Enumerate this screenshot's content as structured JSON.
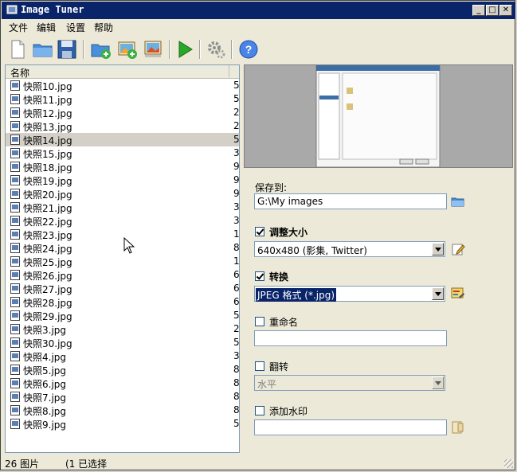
{
  "window": {
    "title": "Image Tuner"
  },
  "menu": [
    "文件",
    "编辑",
    "设置",
    "帮助"
  ],
  "toolbar": {
    "icons": [
      "new-file-icon",
      "open-folder-icon",
      "save-icon",
      "add-folder-icon",
      "add-image-icon",
      "add-image-alt-icon",
      "run-icon",
      "settings-icon",
      "help-icon"
    ]
  },
  "list": {
    "header": "名称",
    "rows": [
      {
        "name": "快照10.jpg",
        "size": "5"
      },
      {
        "name": "快照11.jpg",
        "size": "5"
      },
      {
        "name": "快照12.jpg",
        "size": "2"
      },
      {
        "name": "快照13.jpg",
        "size": "2"
      },
      {
        "name": "快照14.jpg",
        "size": "5"
      },
      {
        "name": "快照15.jpg",
        "size": "3"
      },
      {
        "name": "快照18.jpg",
        "size": "9"
      },
      {
        "name": "快照19.jpg",
        "size": "9"
      },
      {
        "name": "快照20.jpg",
        "size": "9"
      },
      {
        "name": "快照21.jpg",
        "size": "3"
      },
      {
        "name": "快照22.jpg",
        "size": "3"
      },
      {
        "name": "快照23.jpg",
        "size": "1"
      },
      {
        "name": "快照24.jpg",
        "size": "8"
      },
      {
        "name": "快照25.jpg",
        "size": "1"
      },
      {
        "name": "快照26.jpg",
        "size": "6"
      },
      {
        "name": "快照27.jpg",
        "size": "6"
      },
      {
        "name": "快照28.jpg",
        "size": "6"
      },
      {
        "name": "快照29.jpg",
        "size": "5"
      },
      {
        "name": "快照3.jpg",
        "size": "2"
      },
      {
        "name": "快照30.jpg",
        "size": "5"
      },
      {
        "name": "快照4.jpg",
        "size": "3"
      },
      {
        "name": "快照5.jpg",
        "size": "8"
      },
      {
        "name": "快照6.jpg",
        "size": "8"
      },
      {
        "name": "快照7.jpg",
        "size": "8"
      },
      {
        "name": "快照8.jpg",
        "size": "8"
      },
      {
        "name": "快照9.jpg",
        "size": "5"
      }
    ],
    "selected_index": 4
  },
  "settings": {
    "save_to_label": "保存到:",
    "save_to_value": "G:\\My images",
    "resize_label": "调整大小",
    "resize_checked": true,
    "resize_value": "640x480 (影集, Twitter)",
    "convert_label": "转换",
    "convert_checked": true,
    "convert_value": "JPEG 格式 (*.jpg)",
    "rename_label": "重命名",
    "rename_checked": false,
    "rename_value": "",
    "flip_label": "翻转",
    "flip_checked": false,
    "flip_value": "水平",
    "watermark_label": "添加水印",
    "watermark_checked": false,
    "watermark_value": ""
  },
  "status": {
    "count": "26 图片",
    "selected": "(1 已选择"
  }
}
